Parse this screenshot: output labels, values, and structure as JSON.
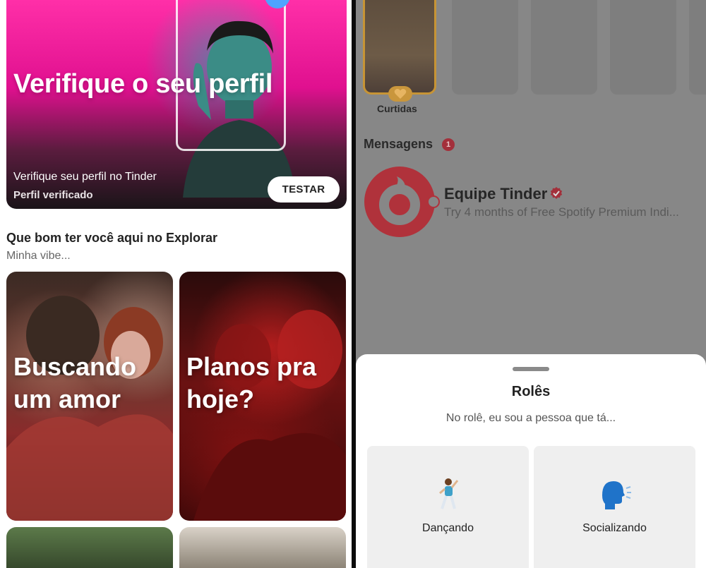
{
  "left": {
    "hero": {
      "title": "Verifique o seu perfil",
      "subtitle": "Verifique seu perfil no Tinder",
      "caption": "Perfil verificado",
      "button": "TESTAR"
    },
    "explore": {
      "title": "Que bom ter você aqui no Explorar",
      "subtitle": "Minha vibe..."
    },
    "cards": [
      {
        "label": "Buscando um amor"
      },
      {
        "label": "Planos pra hoje?"
      }
    ]
  },
  "right": {
    "likes": {
      "label": "Curtidas"
    },
    "messages": {
      "header": "Mensagens",
      "count": "1",
      "item": {
        "name": "Equipe Tinder",
        "preview": "Try 4 months of Free Spotify Premium Indi..."
      }
    },
    "sheet": {
      "title": "Rolês",
      "subtitle": "No rolê, eu sou a pessoa que tá...",
      "options": [
        {
          "label": "Dançando",
          "icon": "dancing-person-icon"
        },
        {
          "label": "Socializando",
          "icon": "speaking-head-icon"
        }
      ]
    }
  },
  "colors": {
    "hero_pink": "#e0108f",
    "tinder_red": "#b0323b",
    "gold": "#c9963c",
    "overlay_gray": "#878787"
  }
}
